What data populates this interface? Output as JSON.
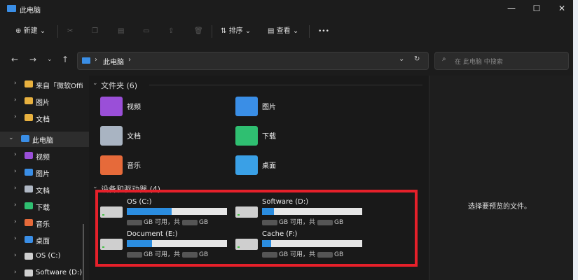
{
  "window": {
    "title": "此电脑",
    "min_icon": "minimize-icon",
    "max_icon": "maximize-icon",
    "close_icon": "close-icon"
  },
  "toolbar": {
    "new_label": "新建",
    "sort_label": "排序",
    "view_label": "查看",
    "more_label": "•••"
  },
  "address": {
    "path": "此电脑",
    "search_placeholder": "在 此电脑 中搜索"
  },
  "sidebar": {
    "items": [
      {
        "label": "来自「微软Offi",
        "color": "#e8b13f"
      },
      {
        "label": "图片",
        "color": "#e8b13f"
      },
      {
        "label": "文档",
        "color": "#e8b13f"
      },
      {
        "label": "此电脑",
        "color": "#3a8ee6"
      },
      {
        "label": "视频",
        "color": "#9a4fd8"
      },
      {
        "label": "图片",
        "color": "#3a8ee6"
      },
      {
        "label": "文档",
        "color": "#b0b8c4"
      },
      {
        "label": "下载",
        "color": "#2fbf71"
      },
      {
        "label": "音乐",
        "color": "#e66a3a"
      },
      {
        "label": "桌面",
        "color": "#3a8ee6"
      },
      {
        "label": "OS (C:)",
        "color": "#cfcfcf"
      },
      {
        "label": "Software (D:)",
        "color": "#cfcfcf"
      }
    ]
  },
  "content": {
    "folders_header": "文件夹 (6)",
    "drives_header": "设备和驱动器 (4)",
    "folders": [
      {
        "name": "视频",
        "color": "#9a4fd8"
      },
      {
        "name": "图片",
        "color": "#3a8ee6"
      },
      {
        "name": "文档",
        "color": "#a9b4c2"
      },
      {
        "name": "下载",
        "color": "#2fbf71"
      },
      {
        "name": "音乐",
        "color": "#e66a3a"
      },
      {
        "name": "桌面",
        "color": "#3aa0e6"
      }
    ],
    "drives": [
      {
        "name": "OS (C:)",
        "used_fraction": 0.45,
        "caption": "GB 可用，共",
        "caption_unit": "GB"
      },
      {
        "name": "Software (D:)",
        "used_fraction": 0.12,
        "caption": "GB 可用，共",
        "caption_unit": "GB"
      },
      {
        "name": "Document (E:)",
        "used_fraction": 0.25,
        "caption": "GB 可用，共",
        "caption_unit": "GB"
      },
      {
        "name": "Cache (F:)",
        "used_fraction": 0.09,
        "caption": "GB 可用，共",
        "caption_unit": "GB"
      }
    ]
  },
  "preview": {
    "message": "选择要预览的文件。"
  },
  "colors": {
    "accent": "#2b8de0",
    "highlight": "#e5202a"
  }
}
